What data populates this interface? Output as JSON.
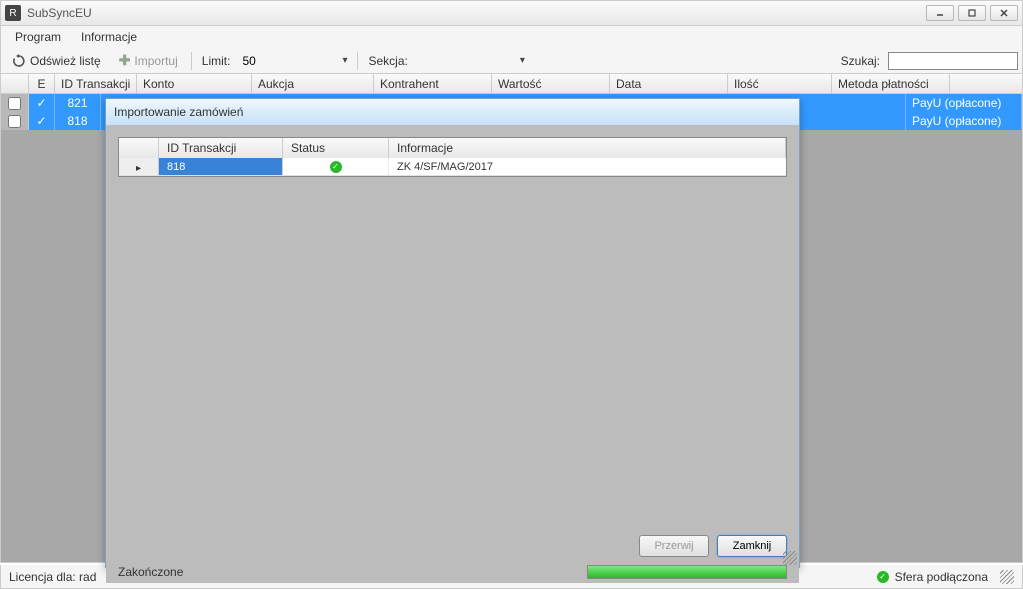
{
  "app": {
    "title": "SubSyncEU",
    "icon_letter": "R"
  },
  "menu": {
    "program": "Program",
    "informacje": "Informacje"
  },
  "toolbar": {
    "refresh": "Odśwież listę",
    "import": "Importuj",
    "limit_label": "Limit:",
    "limit_value": "50",
    "section_label": "Sekcja:",
    "section_value": "",
    "search_label": "Szukaj:",
    "search_value": ""
  },
  "grid": {
    "headers": {
      "check": "",
      "e": "E",
      "id": "ID Transakcji",
      "account": "Konto",
      "auction": "Aukcja",
      "contractor": "Kontrahent",
      "value": "Wartość",
      "date": "Data",
      "qty": "Ilość",
      "payment": "Metoda płatności"
    },
    "rows": [
      {
        "id": "821",
        "payment": "PayU (opłacone)"
      },
      {
        "id": "818",
        "payment": "PayU (opłacone)"
      }
    ]
  },
  "dialog": {
    "title": "Importowanie zamówień",
    "headers": {
      "id": "ID Transakcji",
      "status": "Status",
      "info": "Informacje"
    },
    "rows": [
      {
        "id": "818",
        "info": "ZK 4/SF/MAG/2017"
      }
    ],
    "btn_cancel": "Przerwij",
    "btn_close": "Zamknij",
    "status_text": "Zakończone"
  },
  "statusbar": {
    "license": "Licencja dla: rad",
    "connection": "Sfera podłączona"
  }
}
